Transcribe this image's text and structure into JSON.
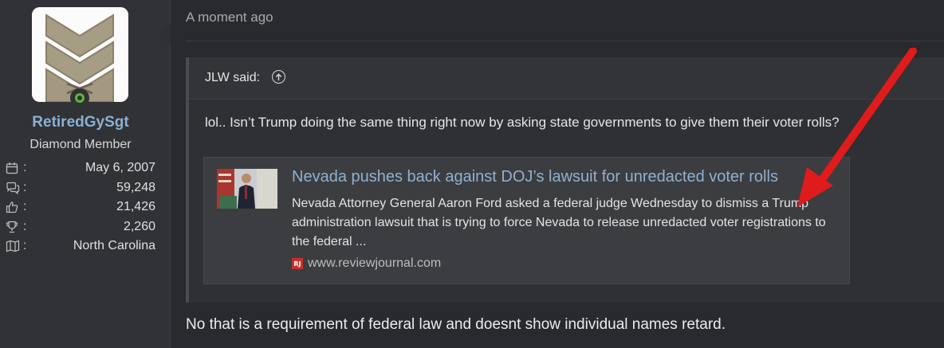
{
  "user": {
    "username": "RetiredGySgt",
    "title": "Diamond Member",
    "stats": [
      {
        "icon": "calendar-icon",
        "value": "May 6, 2007"
      },
      {
        "icon": "messages-icon",
        "value": "59,248"
      },
      {
        "icon": "thumbs-up-icon",
        "value": "21,426"
      },
      {
        "icon": "trophy-icon",
        "value": "2,260"
      },
      {
        "icon": "map-icon",
        "value": "North Carolina"
      }
    ],
    "online_color": "#5db83a"
  },
  "post": {
    "timestamp": "A moment ago",
    "quote": {
      "author": "JLW said:",
      "text": "lol.. Isn’t Trump doing the same thing right now by asking state governments to give them their voter rolls?",
      "embed": {
        "title": "Nevada pushes back against DOJ’s lawsuit for unredacted voter rolls",
        "description": "Nevada Attorney General Aaron Ford asked a federal judge Wednesday to dismiss a Trump administration lawsuit that is trying to force Nevada to release unredacted voter registrations to the federal ...",
        "source": "www.reviewjournal.com",
        "favicon_text": "RJ"
      }
    },
    "reply": "No that is a requirement of federal law and doesnt show individual names retard."
  },
  "colors": {
    "link": "#8fb1cf",
    "username": "#8ab1d3",
    "annotation_arrow": "#e01b1b"
  }
}
